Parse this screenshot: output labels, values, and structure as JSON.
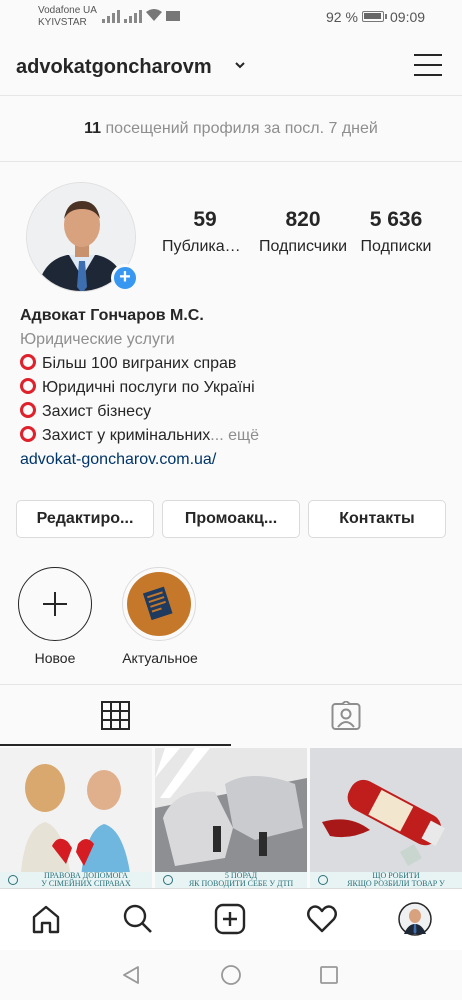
{
  "status_bar": {
    "carrier_line1": "Vodafone UA",
    "carrier_line2": "KYIVSTAR",
    "battery": "92 %",
    "time": "09:09"
  },
  "header": {
    "username": "advokatgoncharovm"
  },
  "visits": {
    "count": "11",
    "text": "посещений профиля за посл. 7 дней"
  },
  "stats": [
    {
      "value": "59",
      "label": "Публикации"
    },
    {
      "value": "820",
      "label": "Подписчики"
    },
    {
      "value": "5 636",
      "label": "Подписки"
    }
  ],
  "bio": {
    "name": "Адвокат Гончаров М.С.",
    "category": "Юридические услуги",
    "lines": [
      "Більш 100 виграних справ",
      "Юридичні послуги по Україні",
      "Захист бізнесу",
      "Захист у кримінальних"
    ],
    "more": "... ещё",
    "link": "advokat-goncharov.com.ua/"
  },
  "buttons": {
    "edit": "Редактиро...",
    "promo": "Промоакц...",
    "contacts": "Контакты"
  },
  "highlights": [
    {
      "label": "Новое"
    },
    {
      "label": "Актуальное"
    }
  ],
  "posts": [
    {
      "caption_line1": "ПРАВОВА ДОПОМОГА",
      "caption_line2": "У СІМЕЙНИХ СПРАВАХ"
    },
    {
      "caption_line1": "5 ПОРАД",
      "caption_line2": "ЯК ПОВОДИТИ СЕБЕ У ДТП"
    },
    {
      "caption_line1": "ЩО РОБИТИ",
      "caption_line2": "ЯКЩО РОЗБИЛИ ТОВАР У"
    }
  ],
  "colors": {
    "accent_blue": "#3897f0",
    "ring_red": "#e0202a",
    "link_blue": "#003569",
    "muted_gray": "#8e8e8e"
  }
}
